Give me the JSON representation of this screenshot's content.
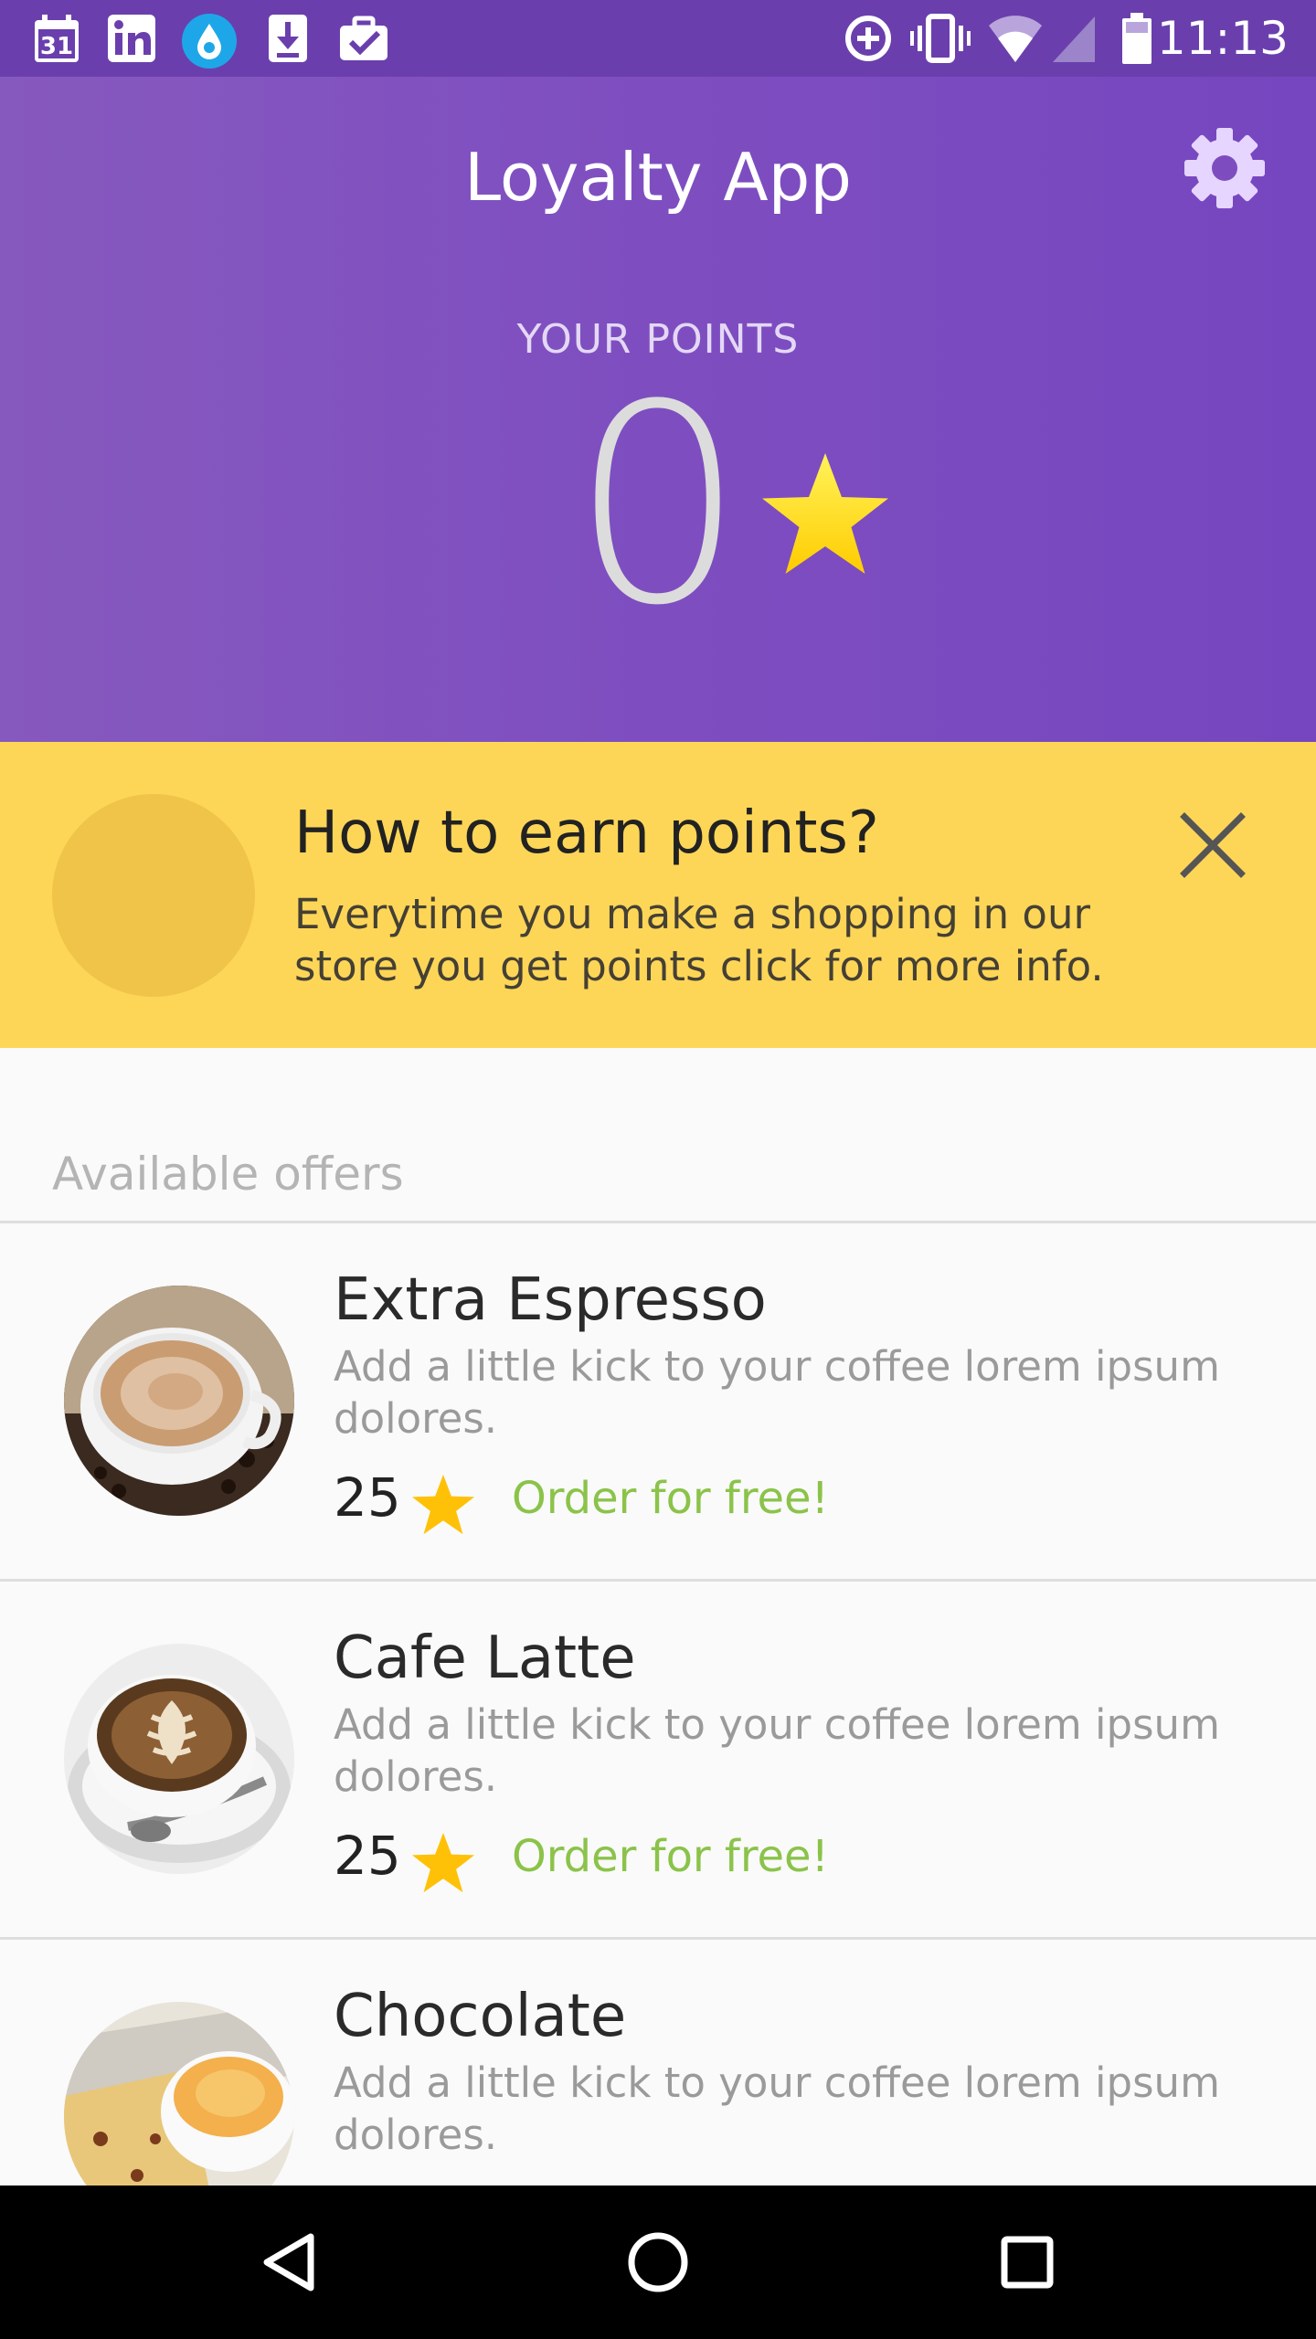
{
  "status_bar": {
    "time": "11:13",
    "calendar_date": "31",
    "icons": [
      "calendar-icon",
      "linkedin-icon",
      "app-drop-icon",
      "download-icon",
      "briefcase-check-icon",
      "data-saver-icon",
      "vibrate-icon",
      "wifi-icon",
      "cell-signal-icon",
      "battery-icon"
    ]
  },
  "header": {
    "title": "Loyalty App",
    "settings_icon": "gear-icon",
    "points_label": "YOUR POINTS",
    "points_value": "0",
    "points_icon": "star-icon"
  },
  "banner": {
    "title": "How to earn points?",
    "text": "Everytime you make a shopping in our store you get points click for more info.",
    "close_icon": "close-icon"
  },
  "offers": {
    "section_title": "Available offers",
    "items": [
      {
        "title": "Extra Espresso",
        "description": "Add a little kick to your coffee lorem ipsum dolores.",
        "points": "25",
        "action": "Order for free!"
      },
      {
        "title": "Cafe Latte",
        "description": "Add a little kick to your coffee lorem ipsum dolores.",
        "points": "25",
        "action": "Order for free!"
      },
      {
        "title": "Chocolate",
        "description": "Add a little kick to your coffee lorem ipsum dolores."
      }
    ]
  },
  "nav_bar": {
    "icons": [
      "back-icon",
      "home-icon",
      "recents-icon"
    ]
  },
  "colors": {
    "status_bar": "#6a3fad",
    "header_start": "#8659be",
    "header_end": "#7646c0",
    "banner": "#fed657",
    "star": "#ffc107",
    "accent_green": "#8bc34a"
  }
}
